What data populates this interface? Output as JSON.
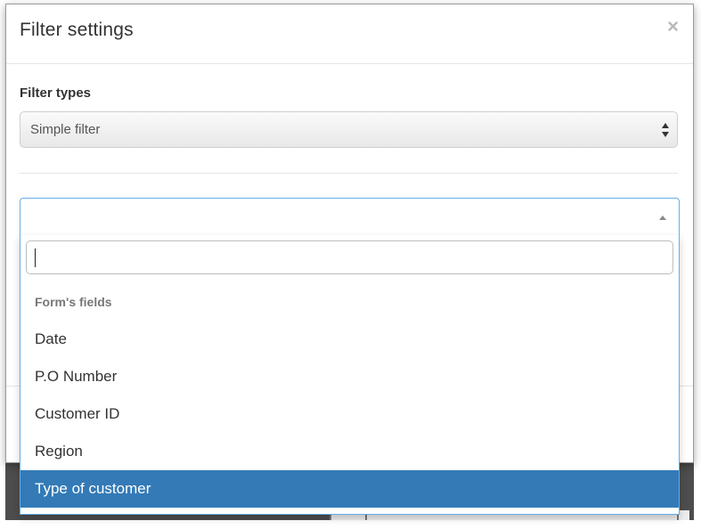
{
  "modal": {
    "title": "Filter settings",
    "close_label": "×"
  },
  "filter_types": {
    "label": "Filter types",
    "selected": "Simple filter"
  },
  "field_picker": {
    "selected_value": "",
    "search_value": "",
    "group_label": "Form's fields",
    "options": [
      {
        "label": "Date",
        "highlighted": false
      },
      {
        "label": "P.O Number",
        "highlighted": false
      },
      {
        "label": "Customer ID",
        "highlighted": false
      },
      {
        "label": "Region",
        "highlighted": false
      },
      {
        "label": "Type of customer",
        "highlighted": true
      }
    ]
  },
  "colors": {
    "highlight": "#337ab7",
    "focus_border": "#66afe9"
  }
}
